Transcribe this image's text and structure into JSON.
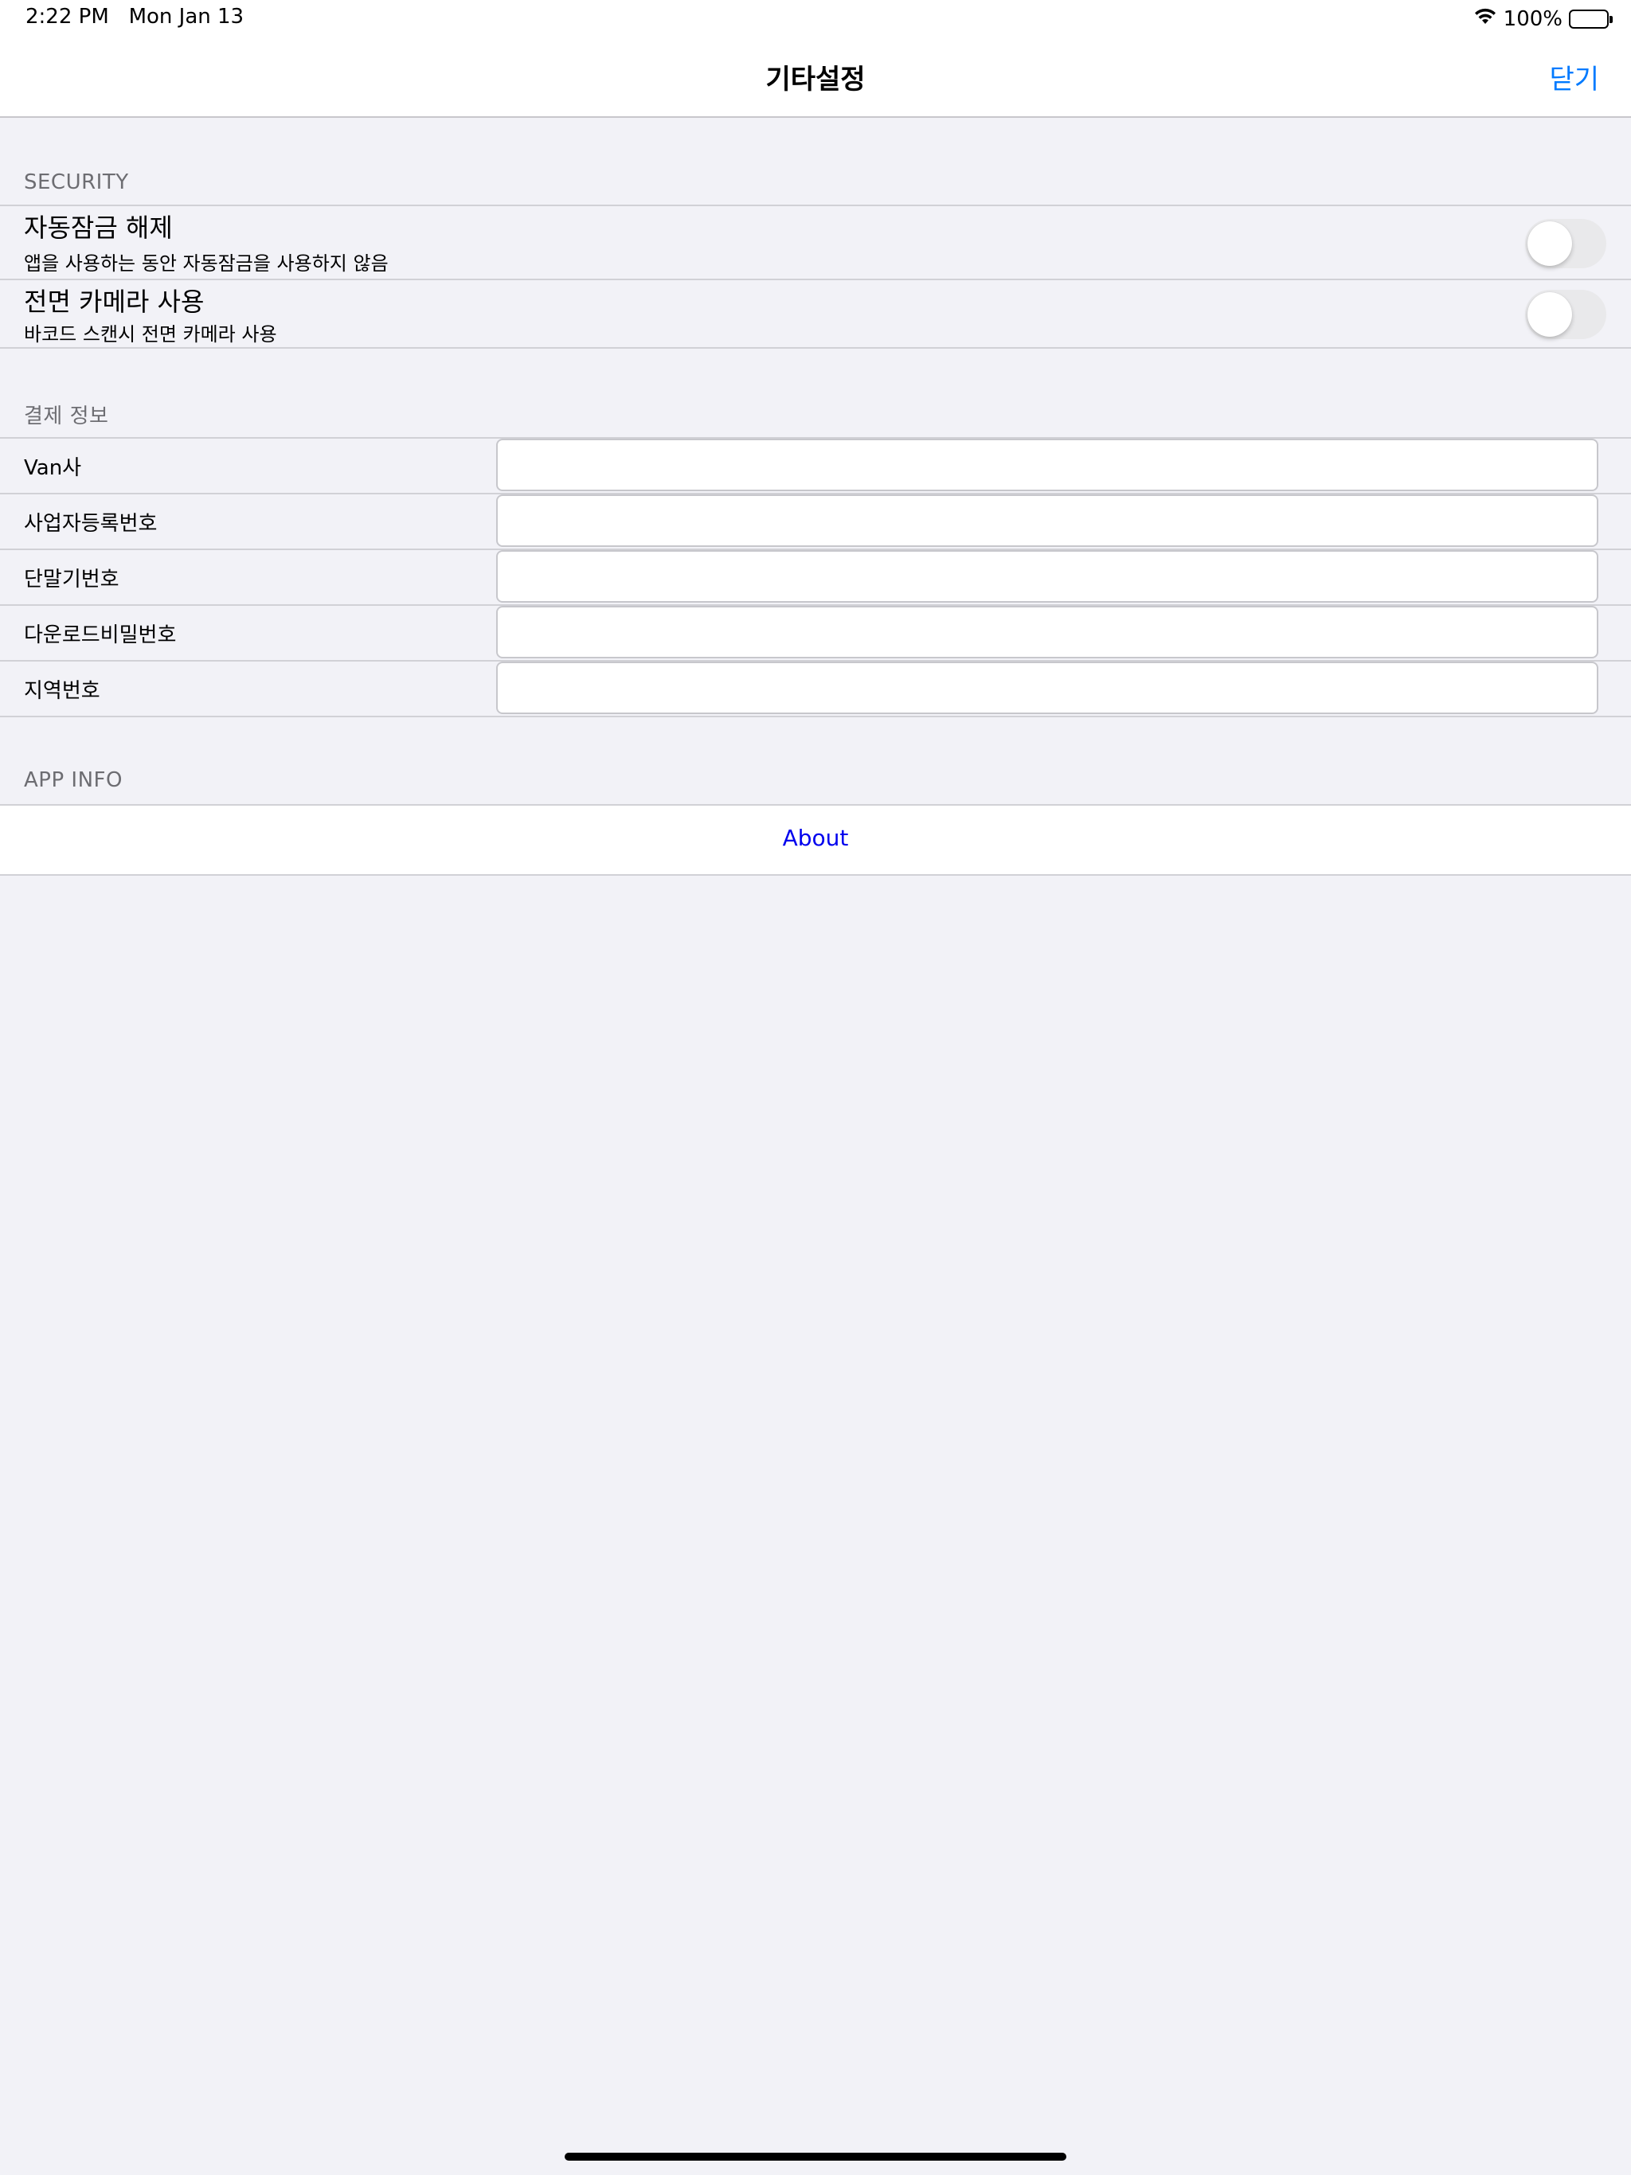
{
  "status_bar": {
    "time": "2:22 PM",
    "date": "Mon Jan 13",
    "battery": "100%",
    "battery_level": 1.0
  },
  "nav": {
    "title": "기타설정",
    "close_label": "닫기",
    "accent_color": "#007aff"
  },
  "security": {
    "header": "SECURITY",
    "items": [
      {
        "title": "자동잠금 해제",
        "subtitle": "앱을 사용하는 동안 자동잠금을 사용하지 않음",
        "on": false
      },
      {
        "title": "전면 카메라 사용",
        "subtitle": "바코드 스캔시 전면 카메라 사용",
        "on": false
      }
    ]
  },
  "payment": {
    "header": "결제 정보",
    "fields": [
      {
        "label": "Van사",
        "value": ""
      },
      {
        "label": "사업자등록번호",
        "value": ""
      },
      {
        "label": "단말기번호",
        "value": ""
      },
      {
        "label": "다운로드비밀번호",
        "value": ""
      },
      {
        "label": "지역번호",
        "value": ""
      }
    ]
  },
  "app_info": {
    "header": "APP INFO",
    "about_label": "About",
    "link_color": "#0000ee"
  }
}
